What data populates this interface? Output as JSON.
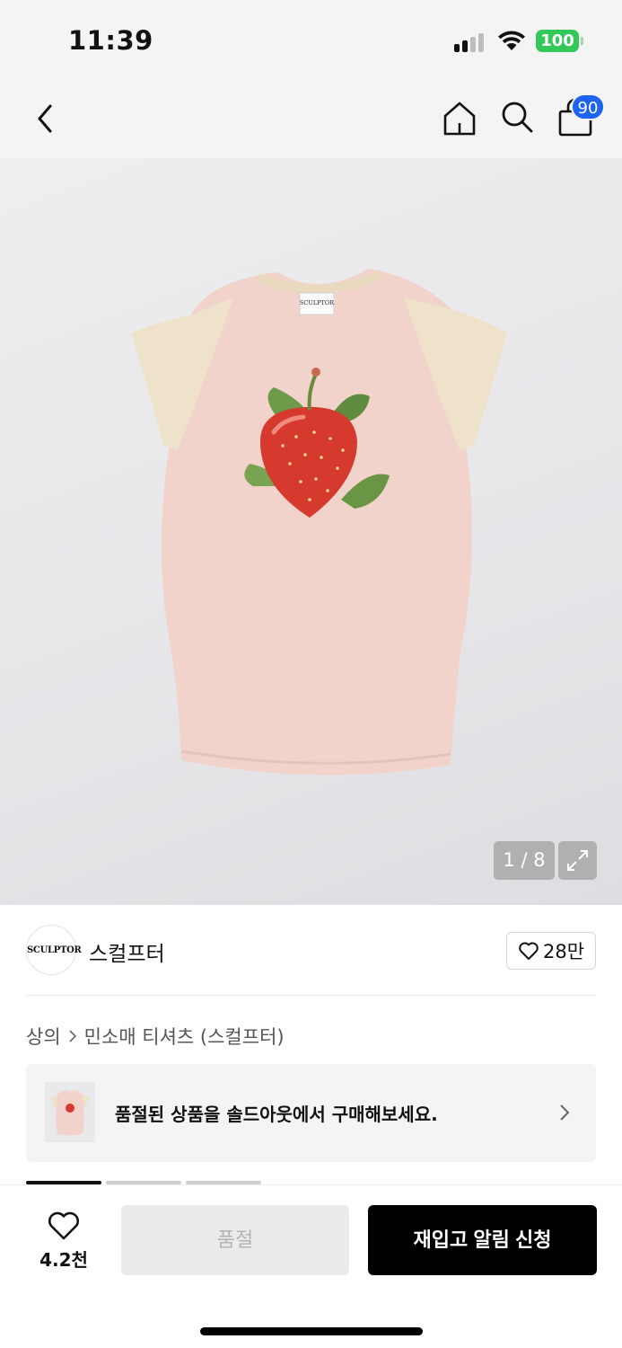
{
  "status_bar": {
    "time": "11:39",
    "battery": "100",
    "icons": [
      "signal-icon",
      "wifi-icon",
      "battery-icon"
    ],
    "battery_color": "#34c759"
  },
  "nav": {
    "icons": [
      "back-icon",
      "home-icon",
      "search-icon",
      "shopping-bag-icon"
    ],
    "cart_count": "90",
    "badge_color": "#1e64f0"
  },
  "gallery": {
    "counter": "1 / 8",
    "expand_icon": "expand-icon"
  },
  "brand": {
    "logo_text": "SCULPTOR",
    "name": "스컬프터",
    "likes": "28만"
  },
  "breadcrumb": {
    "category": "상의",
    "subcategory": "민소매 티셔츠 (스컬프터)"
  },
  "soldout_banner": {
    "text": "품절된 상품을 솔드아웃에서 구매해보세요."
  },
  "bottom_bar": {
    "wish_count": "4.2천",
    "soldout_label": "품절",
    "restock_label": "재입고 알림 신청",
    "primary_color": "#000000"
  }
}
